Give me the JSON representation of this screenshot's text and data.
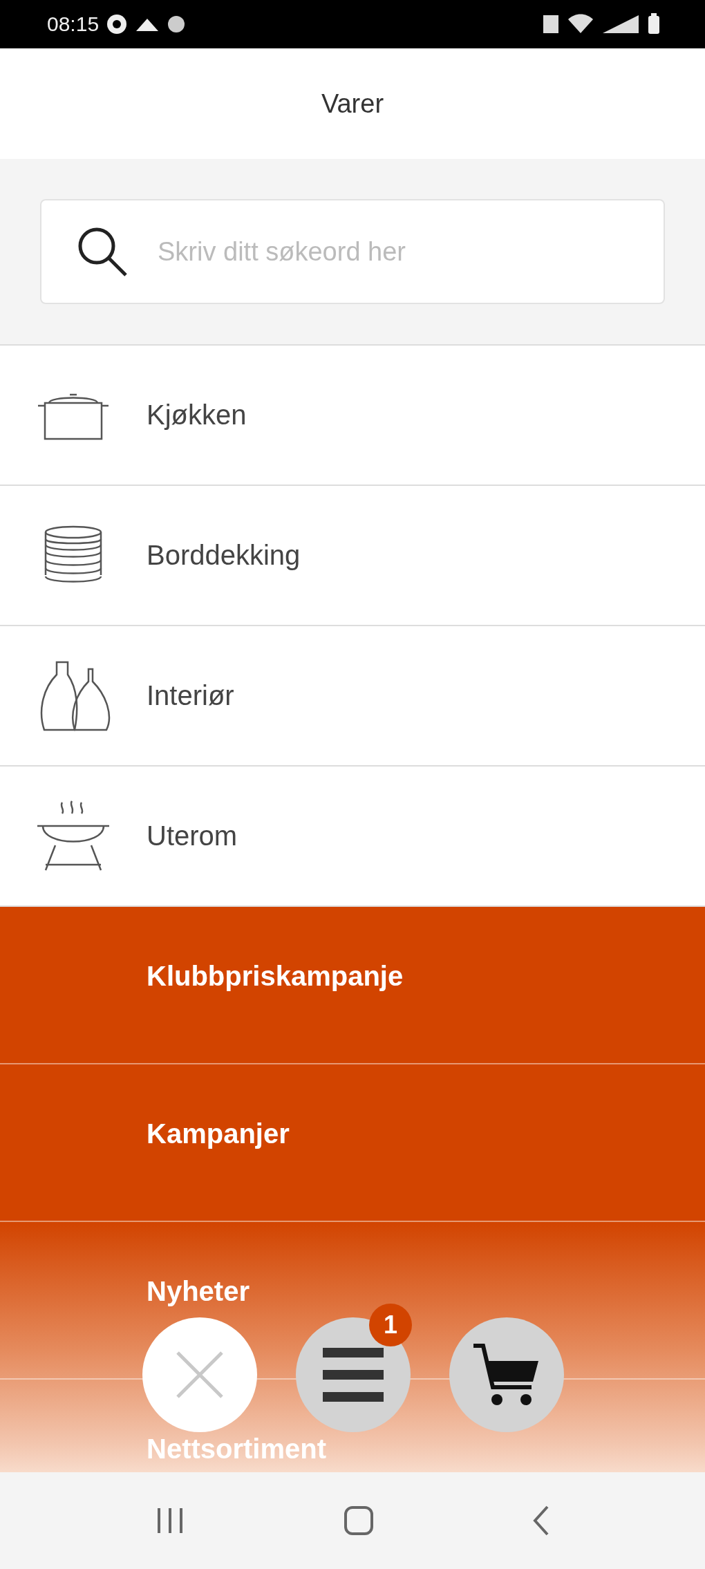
{
  "status_bar": {
    "time": "08:15"
  },
  "header": {
    "title": "Varer"
  },
  "search": {
    "placeholder": "Skriv ditt søkeord her"
  },
  "categories": [
    {
      "kind": "category",
      "label": "Kjøkken"
    },
    {
      "kind": "category",
      "label": "Borddekking"
    },
    {
      "kind": "category",
      "label": "Interiør"
    },
    {
      "kind": "category",
      "label": "Uterom"
    },
    {
      "kind": "campaign",
      "label": "Klubbpriskampanje"
    },
    {
      "kind": "campaign",
      "label": "Kampanjer"
    },
    {
      "kind": "campaign",
      "label": "Nyheter"
    },
    {
      "kind": "campaign",
      "label": "Nettsortiment"
    }
  ],
  "floating_buttons": [
    {
      "kind": "close"
    },
    {
      "kind": "menu",
      "badge": "1"
    },
    {
      "kind": "cart"
    }
  ]
}
